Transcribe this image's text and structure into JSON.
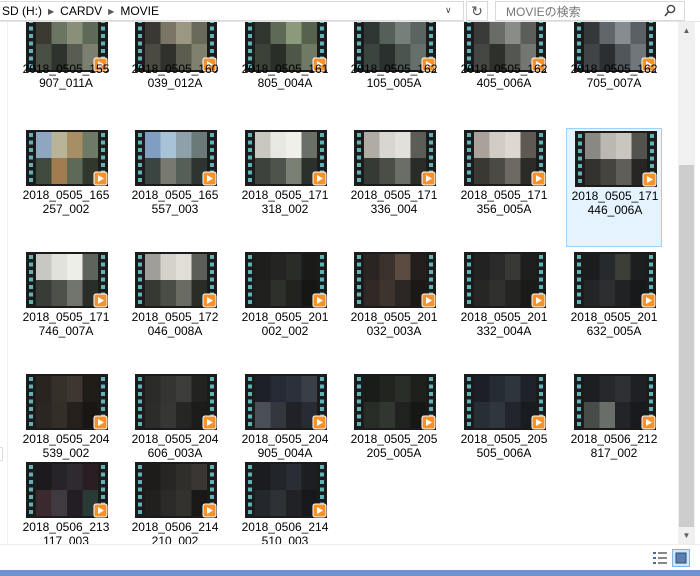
{
  "address": {
    "crumbs": [
      "SD (H:)",
      "CARDV",
      "MOVIE"
    ]
  },
  "search": {
    "placeholder": "MOVIEの検索"
  },
  "files": [
    {
      "line1": "2018_0505_155",
      "line2": "907_011A",
      "selected": false,
      "shades": [
        "#3a3a33",
        "#6b7562",
        "#8a8f7a",
        "#5e6a57",
        "#4a4f45",
        "#2f332d",
        "#585c52",
        "#7b7f70"
      ]
    },
    {
      "line1": "2018_0505_160",
      "line2": "039_012A",
      "selected": false,
      "shades": [
        "#3a3833",
        "#7a7566",
        "#9a9882",
        "#6a6a5a",
        "#4a4a42",
        "#30302c",
        "#5c5c50",
        "#80806e"
      ]
    },
    {
      "line1": "2018_0505_161",
      "line2": "805_004A",
      "selected": false,
      "shades": [
        "#30352f",
        "#5c6a57",
        "#8a9a7a",
        "#56624e",
        "#3d4239",
        "#2a2e28",
        "#4e5648",
        "#6e7a64"
      ]
    },
    {
      "line1": "2018_0505_162",
      "line2": "105_005A",
      "selected": false,
      "shades": [
        "#2f3532",
        "#55605a",
        "#76807a",
        "#5a6460",
        "#3c4440",
        "#2a302d",
        "#4c5450",
        "#66706a"
      ]
    },
    {
      "line1": "2018_0505_162",
      "line2": "405_006A",
      "selected": false,
      "shades": [
        "#3a3a38",
        "#6a6c68",
        "#8a8c88",
        "#5c5e5a",
        "#444642",
        "#2e302c",
        "#545652",
        "#747672"
      ]
    },
    {
      "line1": "2018_0505_162",
      "line2": "705_007A",
      "selected": false,
      "shades": [
        "#35383a",
        "#60666a",
        "#868c90",
        "#5a6064",
        "#404446",
        "#2c2f31",
        "#50565a",
        "#70767a"
      ]
    },
    {
      "line1": "2018_0505_165",
      "line2": "257_002",
      "selected": false,
      "shades": [
        "#8ea6c0",
        "#b7b498",
        "#a88e64",
        "#6e7a66",
        "#3e4a3e",
        "#a07c50",
        "#5e6a58",
        "#32372e"
      ]
    },
    {
      "line1": "2018_0505_165",
      "line2": "557_003",
      "selected": false,
      "shades": [
        "#7f9ec2",
        "#a8c3d8",
        "#8ea0aa",
        "#6a7a78",
        "#3a4440",
        "#787a70",
        "#565e58",
        "#2e3430"
      ]
    },
    {
      "line1": "2018_0505_171",
      "line2": "318_002",
      "selected": false,
      "shades": [
        "#c8c8c0",
        "#e8e8e2",
        "#f0f0ea",
        "#6a7068",
        "#3e423c",
        "#4e544c",
        "#7a8074",
        "#2c302a"
      ]
    },
    {
      "line1": "2018_0505_171",
      "line2": "336_004",
      "selected": false,
      "shades": [
        "#b0aca4",
        "#d8d6d0",
        "#e2e0da",
        "#5a5e56",
        "#363a34",
        "#4a4e46",
        "#6a6e66",
        "#2a2c28"
      ]
    },
    {
      "line1": "2018_0505_171",
      "line2": "356_005A",
      "selected": false,
      "shades": [
        "#a8a29a",
        "#d0ccc4",
        "#dcd8d0",
        "#5e5a52",
        "#3a3832",
        "#4c4a44",
        "#6c6a62",
        "#2c2a26"
      ]
    },
    {
      "line1": "2018_0505_171",
      "line2": "446_006A",
      "selected": true,
      "shades": [
        "#8a8882",
        "#bab8b0",
        "#c8c6be",
        "#54524c",
        "#34322e",
        "#46443e",
        "#605e58",
        "#282624"
      ]
    },
    {
      "line1": "2018_0505_171",
      "line2": "746_007A",
      "selected": false,
      "shades": [
        "#c8c8c2",
        "#e2e2dc",
        "#eeeee8",
        "#5e645c",
        "#383c36",
        "#4c5048",
        "#70746c",
        "#2a2e28"
      ]
    },
    {
      "line1": "2018_0505_172",
      "line2": "046_008A",
      "selected": false,
      "shades": [
        "#a09e98",
        "#d4d2ca",
        "#e0ded6",
        "#5a5e56",
        "#363832",
        "#4a4c46",
        "#6a6c64",
        "#2a2c26"
      ]
    },
    {
      "line1": "2018_0505_201",
      "line2": "002_002",
      "selected": false,
      "shades": [
        "#1e1e1c",
        "#242422",
        "#2a2c28",
        "#1a1a18",
        "#20201e",
        "#2e302c",
        "#22221f",
        "#161614"
      ]
    },
    {
      "line1": "2018_0505_201",
      "line2": "032_003A",
      "selected": false,
      "shades": [
        "#2a2422",
        "#3a302c",
        "#5a4a40",
        "#241e1c",
        "#302824",
        "#3e342e",
        "#2c2624",
        "#1c1816"
      ]
    },
    {
      "line1": "2018_0505_201",
      "line2": "332_004A",
      "selected": false,
      "shades": [
        "#222222",
        "#2a2a2a",
        "#383836",
        "#1e1e1e",
        "#262624",
        "#30302e",
        "#242422",
        "#1a1a18"
      ]
    },
    {
      "line1": "2018_0505_201",
      "line2": "632_005A",
      "selected": false,
      "shades": [
        "#1a1c1e",
        "#262a2c",
        "#3a3e36",
        "#1c1e20",
        "#222426",
        "#2c2e30",
        "#202224",
        "#16181a"
      ]
    },
    {
      "line1": "2018_0505_204",
      "line2": "539_002",
      "selected": false,
      "shades": [
        "#2a2420",
        "#36302a",
        "#3e3630",
        "#201c18",
        "#2c2622",
        "#342e28",
        "#26201c",
        "#1a1614"
      ]
    },
    {
      "line1": "2018_0505_204",
      "line2": "606_003A",
      "selected": false,
      "shades": [
        "#2a2a28",
        "#343432",
        "#3c3c3a",
        "#222220",
        "#2c2c2a",
        "#363634",
        "#262624",
        "#1c1c1a"
      ]
    },
    {
      "line1": "2018_0505_204",
      "line2": "905_004A",
      "selected": false,
      "shades": [
        "#1e2028",
        "#262a34",
        "#2c303a",
        "#3a3e46",
        "#4a4e56",
        "#34383e",
        "#202228",
        "#282c32"
      ]
    },
    {
      "line1": "2018_0505_205",
      "line2": "205_005A",
      "selected": false,
      "shades": [
        "#1a1c1a",
        "#222420",
        "#2a2e28",
        "#1e201c",
        "#282c26",
        "#323630",
        "#202220",
        "#161816"
      ]
    },
    {
      "line1": "2018_0505_205",
      "line2": "505_006A",
      "selected": false,
      "shades": [
        "#1c2026",
        "#262c34",
        "#2e343c",
        "#1e2228",
        "#282e36",
        "#30363e",
        "#22262c",
        "#181c20"
      ]
    },
    {
      "line1": "2018_0506_212",
      "line2": "817_002",
      "selected": false,
      "shades": [
        "#1c1e22",
        "#26282c",
        "#2e3034",
        "#1e2024",
        "#484c48",
        "#6a6e68",
        "#222428",
        "#181a1e"
      ]
    },
    {
      "line1": "2018_0506_213",
      "line2": "117_003",
      "selected": false,
      "shades": [
        "#1c1a1e",
        "#262428",
        "#2e2a30",
        "#2a1e24",
        "#3a2a30",
        "#3e3a40",
        "#221e24",
        "#2a3a34"
      ]
    },
    {
      "line1": "2018_0506_214",
      "line2": "210_002",
      "selected": false,
      "shades": [
        "#1e1c1a",
        "#282624",
        "#302e2a",
        "#3a3634",
        "#22201e",
        "#2c2a28",
        "#34322e",
        "#1a1816"
      ]
    },
    {
      "line1": "2018_0506_214",
      "line2": "510_003",
      "selected": false,
      "shades": [
        "#1a1c20",
        "#22262a",
        "#2a2e34",
        "#1c1e22",
        "#24282c",
        "#2e3236",
        "#202226",
        "#16181c"
      ]
    }
  ],
  "icons": {
    "refresh": "refresh-icon",
    "search": "search-icon",
    "play_badge": "play-badge-icon",
    "film_strip": "film-strip-icon"
  },
  "colors": {
    "play_badge": "#f5922a",
    "film_sprocket": "#5fb3b8",
    "selection_bg": "#e5f3ff",
    "selection_border": "#99d1ff"
  }
}
